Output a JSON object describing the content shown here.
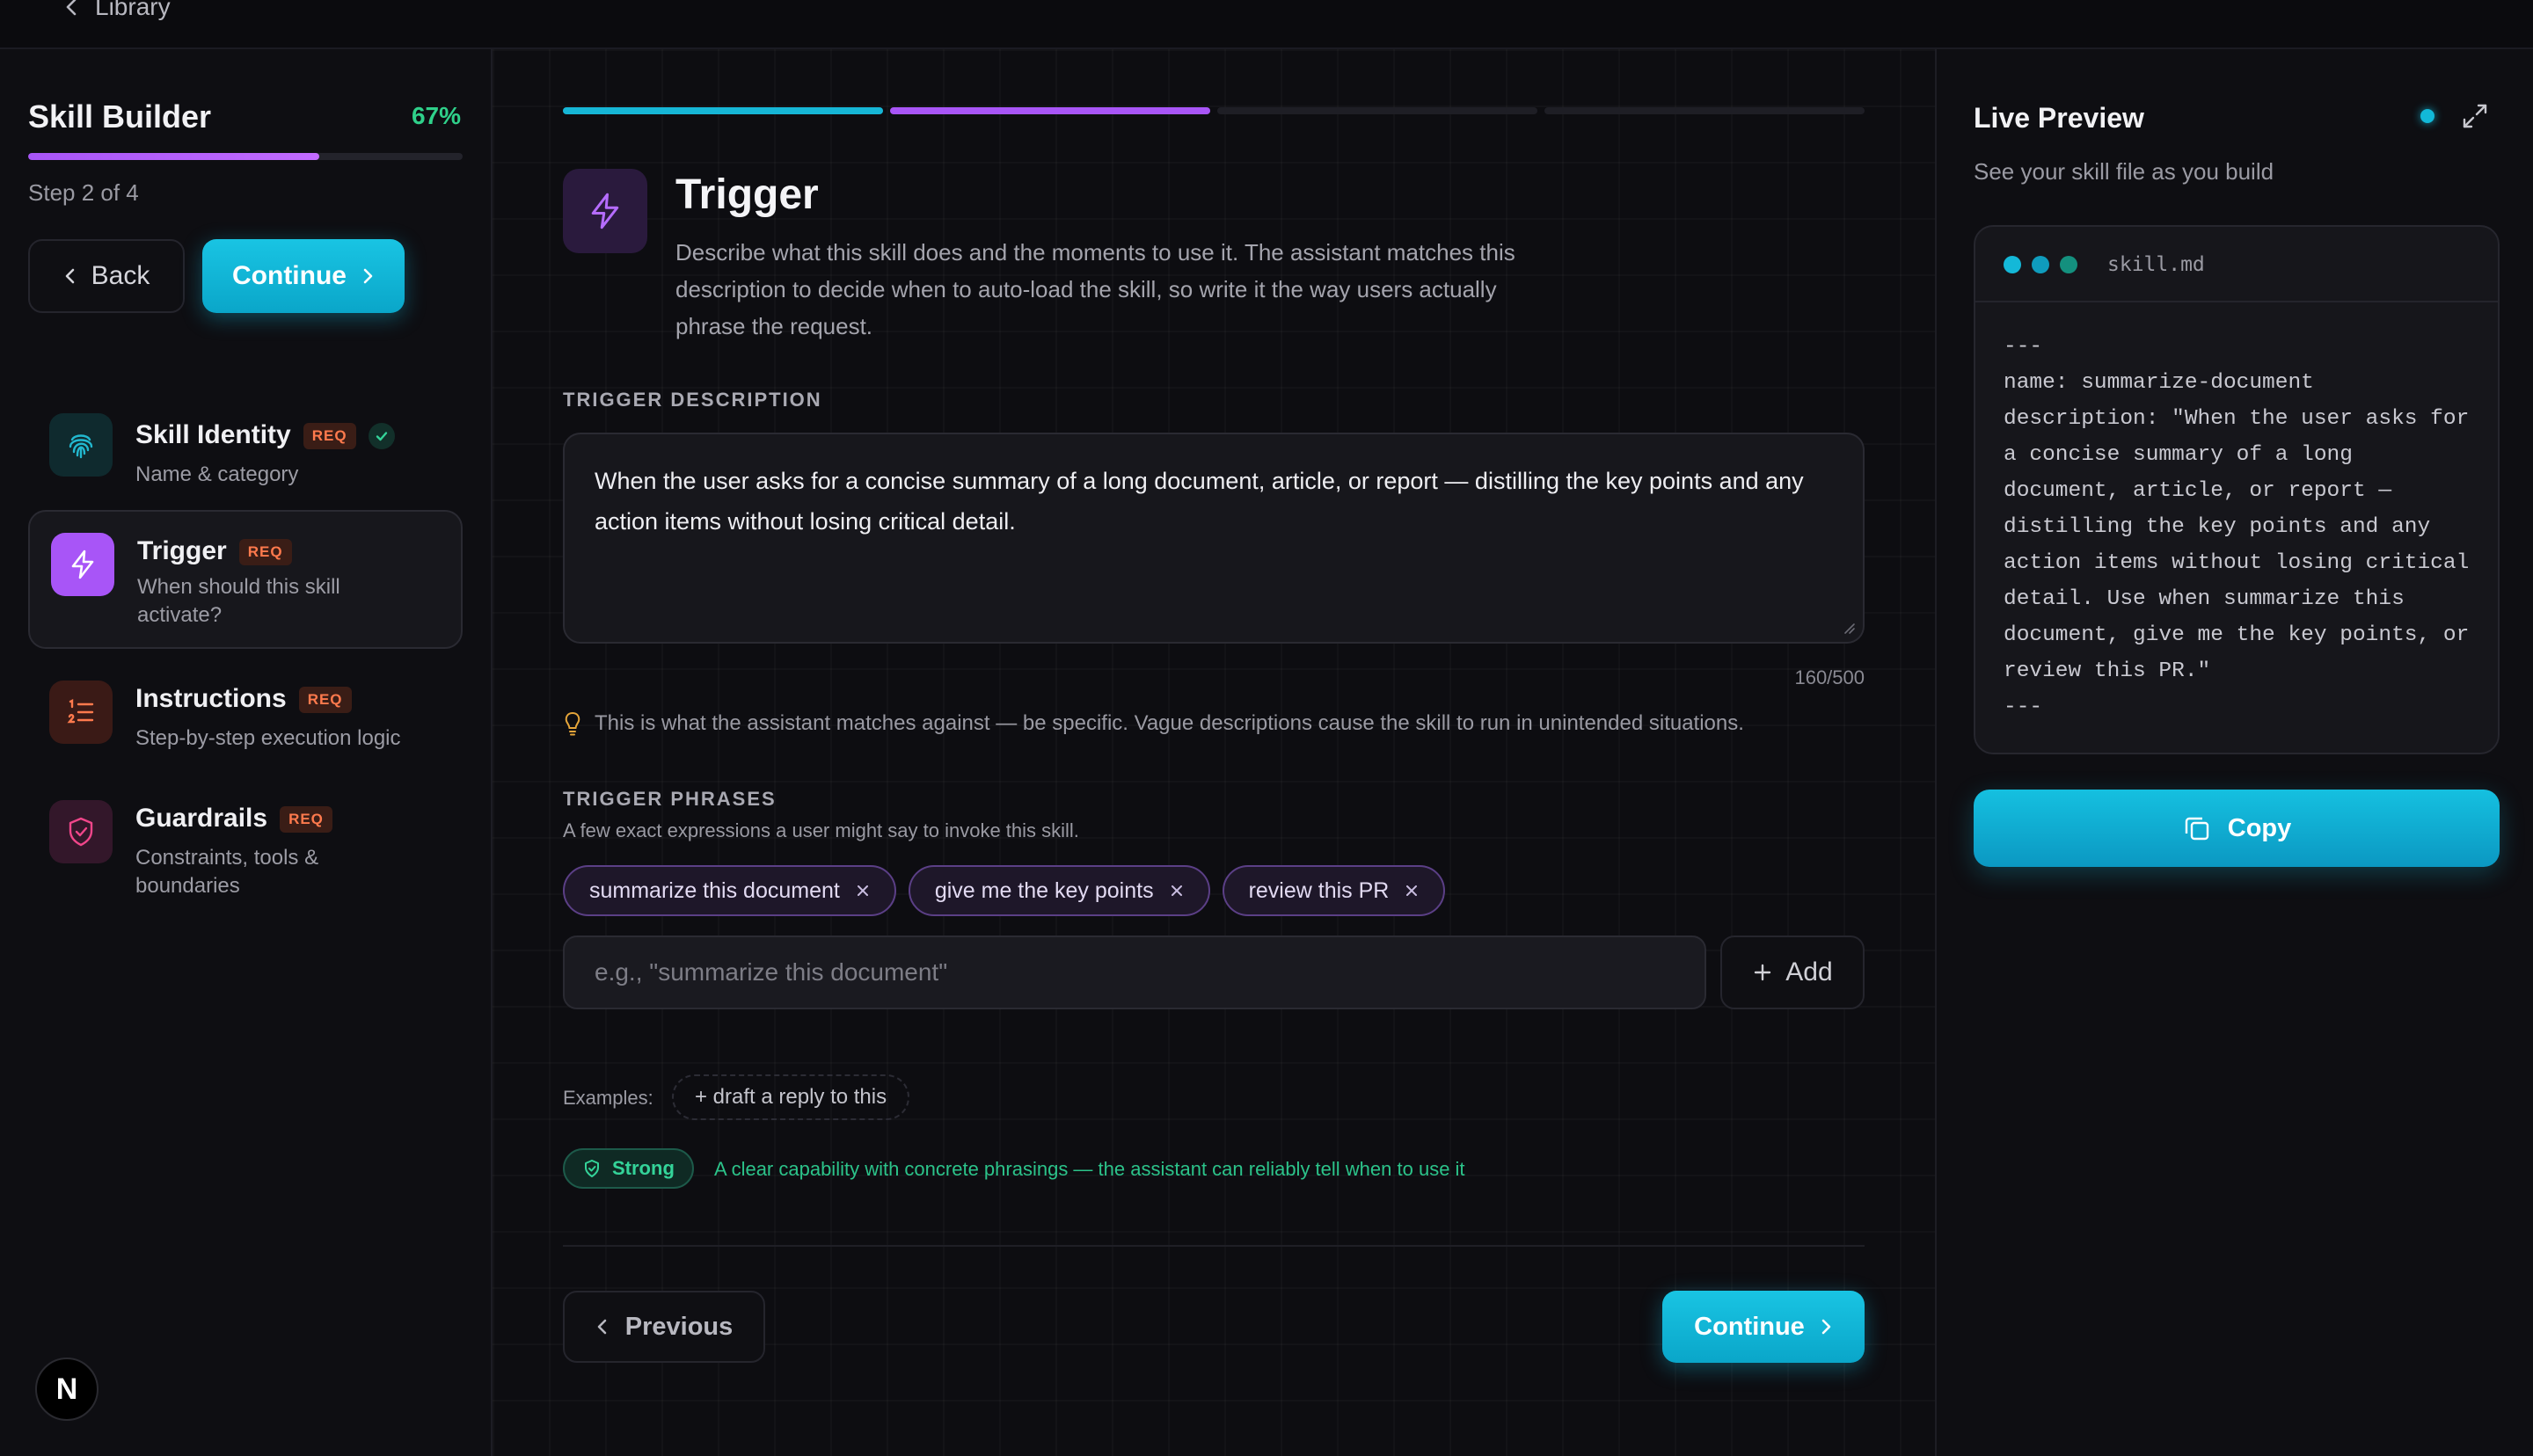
{
  "topbar": {
    "back_label": "Library"
  },
  "sidebar": {
    "title": "Skill Builder",
    "percent": "67%",
    "progress_fraction": 0.67,
    "step_text": "Step 2 of 4",
    "back_label": "Back",
    "continue_label": "Continue",
    "steps": [
      {
        "title": "Skill Identity",
        "badge": "REQ",
        "subtitle": "Name & category",
        "icon": "fingerprint-icon",
        "completed": true
      },
      {
        "title": "Trigger",
        "badge": "REQ",
        "subtitle": "When should this skill activate?",
        "icon": "lightning-icon",
        "active": true
      },
      {
        "title": "Instructions",
        "badge": "REQ",
        "subtitle": "Step-by-step execution logic",
        "icon": "numbered-list-icon"
      },
      {
        "title": "Guardrails",
        "badge": "REQ",
        "subtitle": "Constraints, tools & boundaries",
        "icon": "shield-icon"
      }
    ],
    "logo_letter": "N"
  },
  "main": {
    "progress_segments": [
      "complete",
      "current",
      "upcoming",
      "upcoming"
    ],
    "title": "Trigger",
    "description": "Describe what this skill does and the moments to use it. The assistant matches this description to decide when to auto-load the skill, so write it the way users actually phrase the request.",
    "trigger_label": "TRIGGER DESCRIPTION",
    "trigger_value": "When the user asks for a concise summary of a long document, article, or report — distilling the key points and any action items without losing critical detail.",
    "char_count": "160/500",
    "hint": "This is what the assistant matches against — be specific. Vague descriptions cause the skill to run in unintended situations.",
    "phrases_label": "TRIGGER PHRASES",
    "phrases_sub": "A few exact expressions a user might say to invoke this skill.",
    "phrases": [
      "summarize this document",
      "give me the key points",
      "review this PR"
    ],
    "phrase_placeholder": "e.g., \"summarize this document\"",
    "add_label": "Add",
    "examples_label": "Examples:",
    "example_chip": "+ draft a reply to this",
    "strength_label": "Strong",
    "strength_text": "A clear capability with concrete phrasings — the assistant can reliably tell when to use it",
    "previous_label": "Previous",
    "continue_label": "Continue"
  },
  "preview": {
    "title": "Live Preview",
    "subtitle": "See your skill file as you build",
    "filename": "skill.md",
    "code": "---\nname: summarize-document\ndescription: \"When the user asks for a concise summary of a long document, article, or report — distilling the key points and any action items without losing critical detail. Use when summarize this document, give me the key points, or review this PR.\"\n---",
    "copy_label": "Copy"
  },
  "colors": {
    "accent_cyan": "#12b8d8",
    "accent_purple": "#a855f7",
    "success_green": "#34d399",
    "req_orange": "#ff7a4d"
  }
}
